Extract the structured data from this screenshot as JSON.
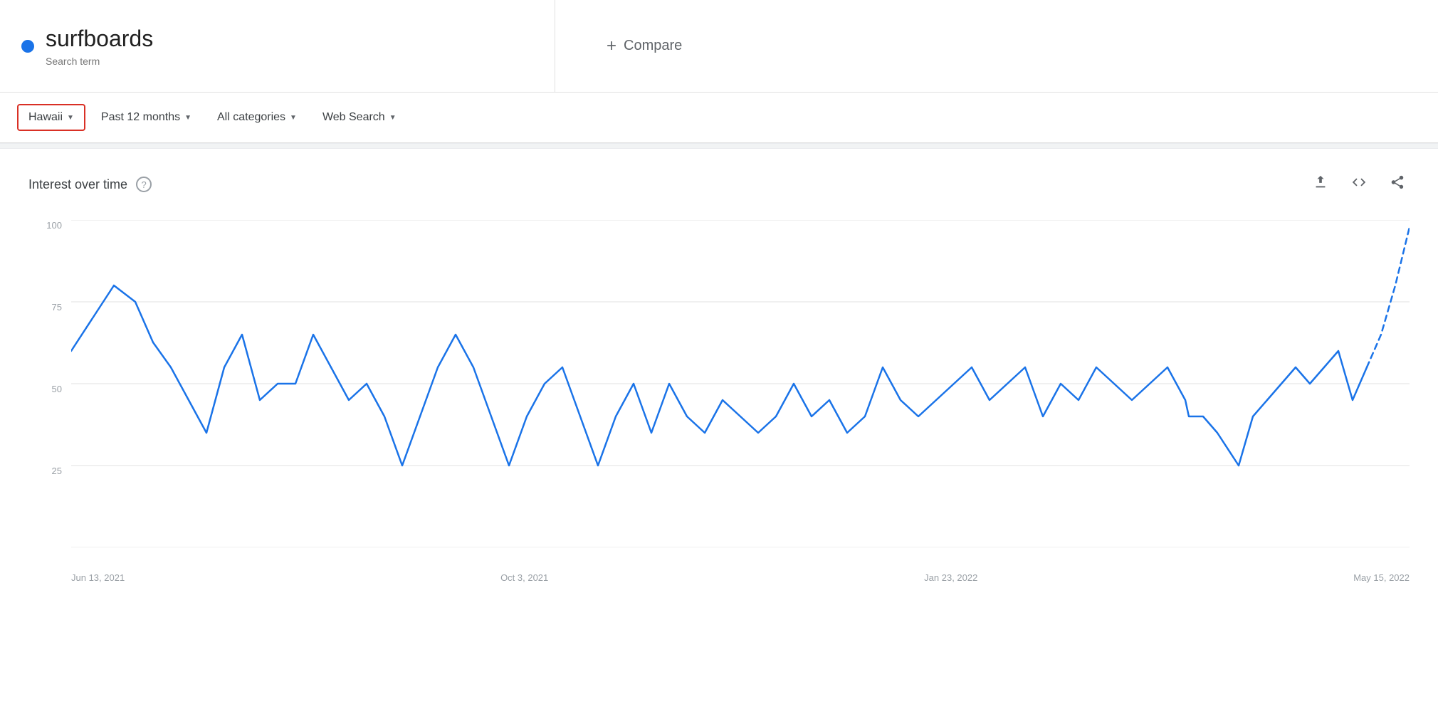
{
  "header": {
    "search_term": "surfboards",
    "search_term_label": "Search term",
    "dot_color": "#1a73e8",
    "compare_label": "Compare"
  },
  "filters": {
    "region": {
      "label": "Hawaii",
      "highlighted": true
    },
    "time": {
      "label": "Past 12 months"
    },
    "category": {
      "label": "All categories"
    },
    "search_type": {
      "label": "Web Search"
    }
  },
  "chart": {
    "title": "Interest over time",
    "help_icon": "?",
    "y_labels": [
      "100",
      "75",
      "50",
      "25"
    ],
    "x_labels": [
      "Jun 13, 2021",
      "Oct 3, 2021",
      "Jan 23, 2022",
      "May 15, 2022"
    ],
    "actions": {
      "download": "⬇",
      "embed": "<>",
      "share": "⬆"
    }
  }
}
